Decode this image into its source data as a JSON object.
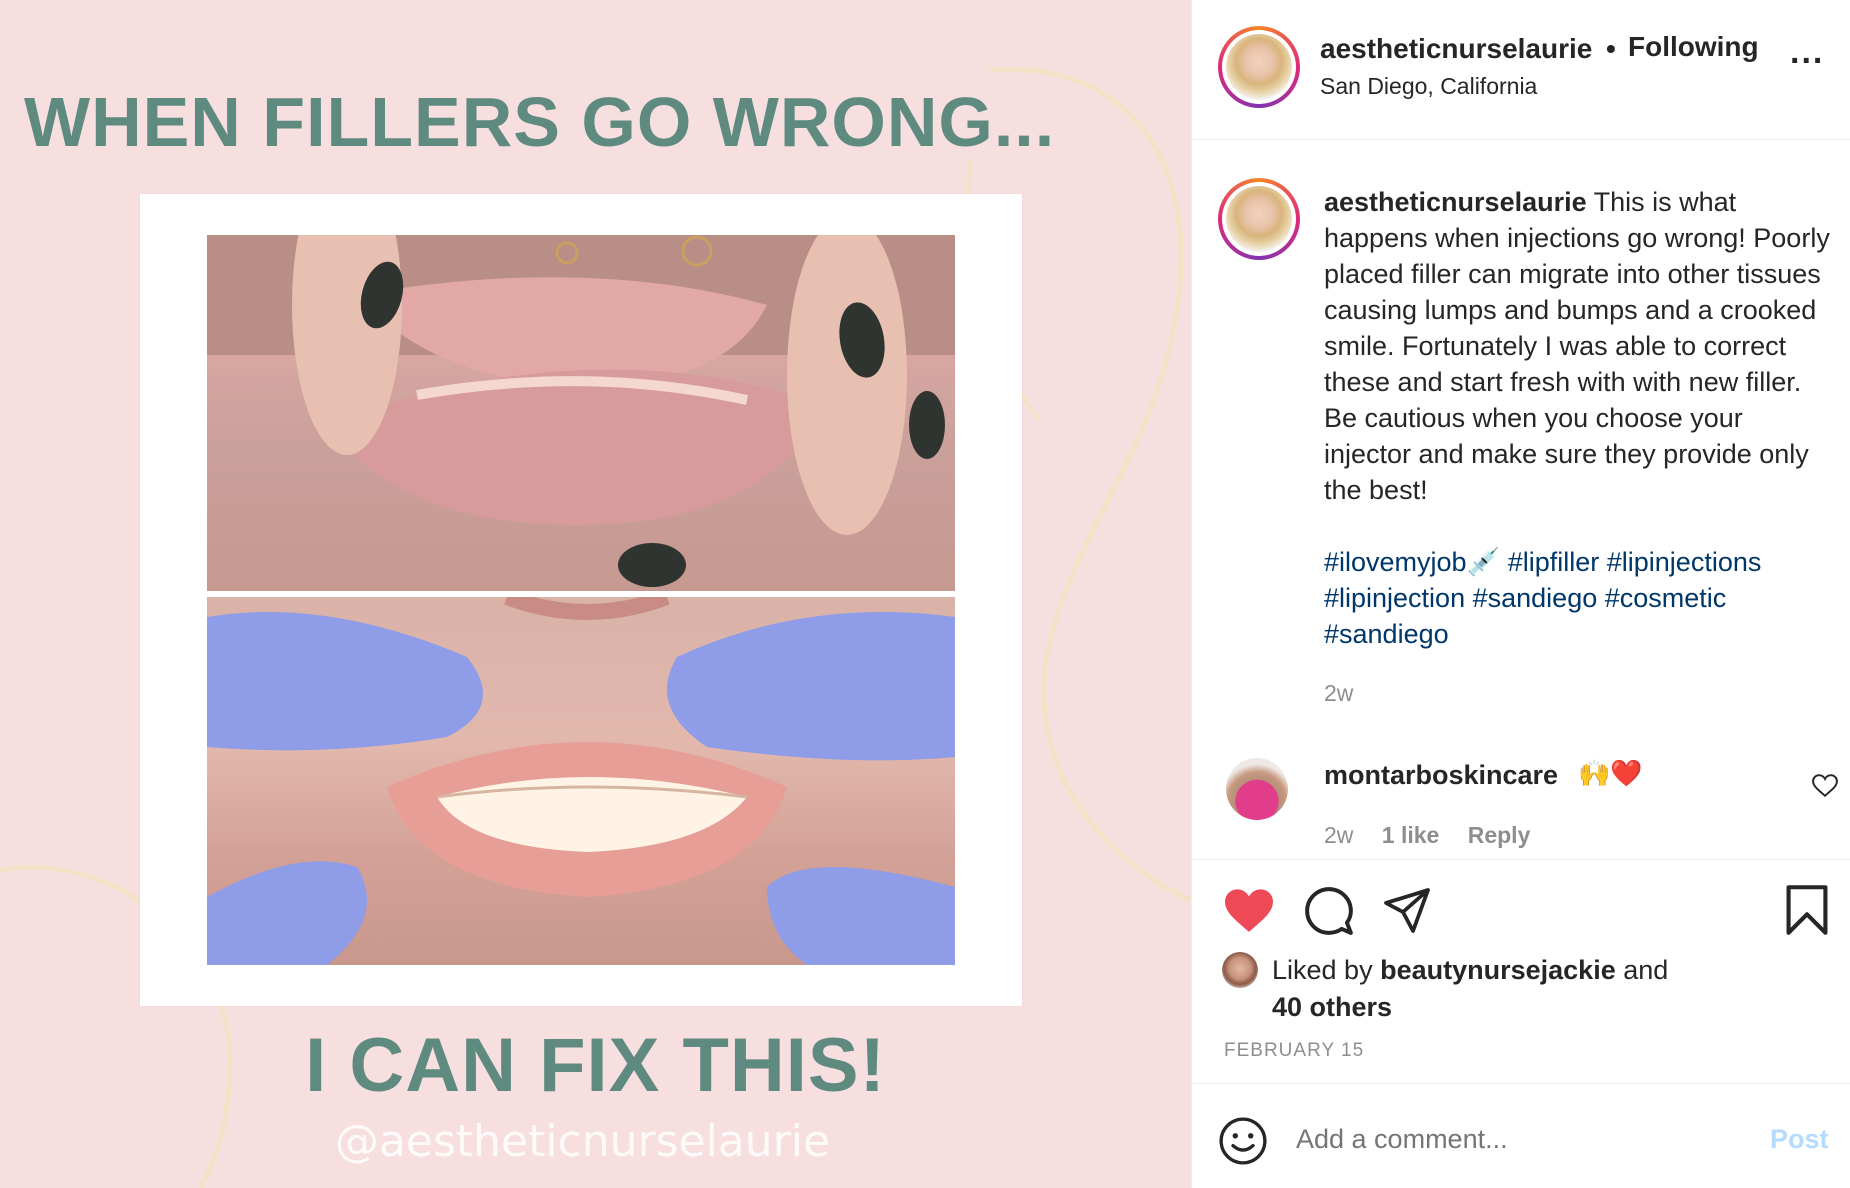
{
  "post_image": {
    "headline": "WHEN FILLERS GO WRONG...",
    "subline": "I CAN FIX THIS!",
    "watermark": "@aestheticnurselaurie",
    "background_color": "#f7dfe0",
    "text_color": "#5f8a80"
  },
  "header": {
    "username": "aestheticnurselaurie",
    "separator": "•",
    "follow_state": "Following",
    "location": "San Diego, California",
    "more_label": "..."
  },
  "caption": {
    "username": "aestheticnurselaurie",
    "text": "This is what happens when injections go wrong! Poorly placed filler can migrate into other tissues causing lumps and bumps and a crooked smile. Fortunately I was able to correct these and start fresh with with new filler. Be cautious when you choose your injector and make sure they provide only the best!",
    "hashtags": [
      "#ilovemyjob💉",
      "#lipfiller",
      "#lipinjections",
      "#lipinjection",
      "#sandiego",
      "#cosmetic",
      "#sandiego"
    ],
    "time": "2w"
  },
  "comment": {
    "username": "montarboskincare",
    "emoji": "🙌❤️",
    "time": "2w",
    "likes": "1 like",
    "reply": "Reply"
  },
  "engagement": {
    "liked_prefix": "Liked by",
    "liked_user": "beautynursejackie",
    "liked_and": "and",
    "others": "40 others",
    "date": "FEBRUARY 15",
    "heart_color": "#ed4956"
  },
  "add_comment": {
    "placeholder": "Add a comment...",
    "post_label": "Post"
  }
}
